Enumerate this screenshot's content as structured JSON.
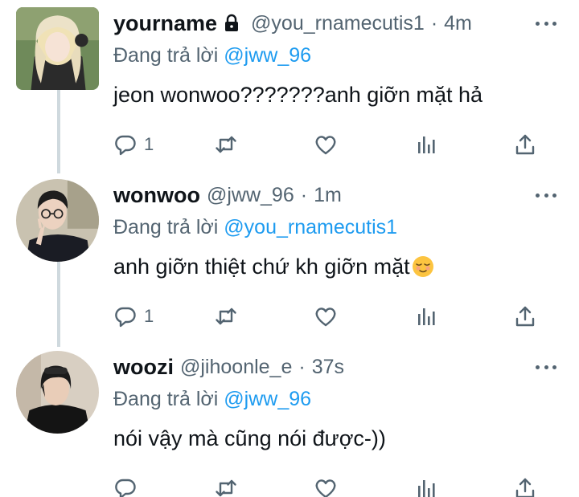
{
  "colors": {
    "text_primary": "#0f1419",
    "text_secondary": "#536471",
    "mention_blue": "#1d9bf0",
    "thread_line": "#cfd9de"
  },
  "tweets": [
    {
      "name": "yourname",
      "protected_icon": "lock-icon",
      "handle": "@you_rnamecutis1",
      "separator": "·",
      "time": "4m",
      "replying_prefix": "Đang trả lời",
      "replying_to": "@jww_96",
      "text": "jeon wonwoo???????anh giỡn mặt hả",
      "reply_count": "1",
      "icons": [
        "reply-icon",
        "retweet-icon",
        "like-icon",
        "analytics-icon",
        "share-icon",
        "more-icon"
      ]
    },
    {
      "name": "wonwoo",
      "handle": "@jww_96",
      "separator": "·",
      "time": "1m",
      "replying_prefix": "Đang trả lời",
      "replying_to": "@you_rnamecutis1",
      "text": "anh giỡn thiệt chứ kh giỡn mặt",
      "trailing_emoji": "relieved-face-emoji",
      "reply_count": "1",
      "icons": [
        "reply-icon",
        "retweet-icon",
        "like-icon",
        "analytics-icon",
        "share-icon",
        "more-icon"
      ]
    },
    {
      "name": "woozi",
      "handle": "@jihoonle_e",
      "separator": "·",
      "time": "37s",
      "replying_prefix": "Đang trả lời",
      "replying_to": "@jww_96",
      "text": "nói vậy mà cũng nói được-))",
      "reply_count": "",
      "icons": [
        "reply-icon",
        "retweet-icon",
        "like-icon",
        "analytics-icon",
        "share-icon",
        "more-icon"
      ]
    }
  ]
}
